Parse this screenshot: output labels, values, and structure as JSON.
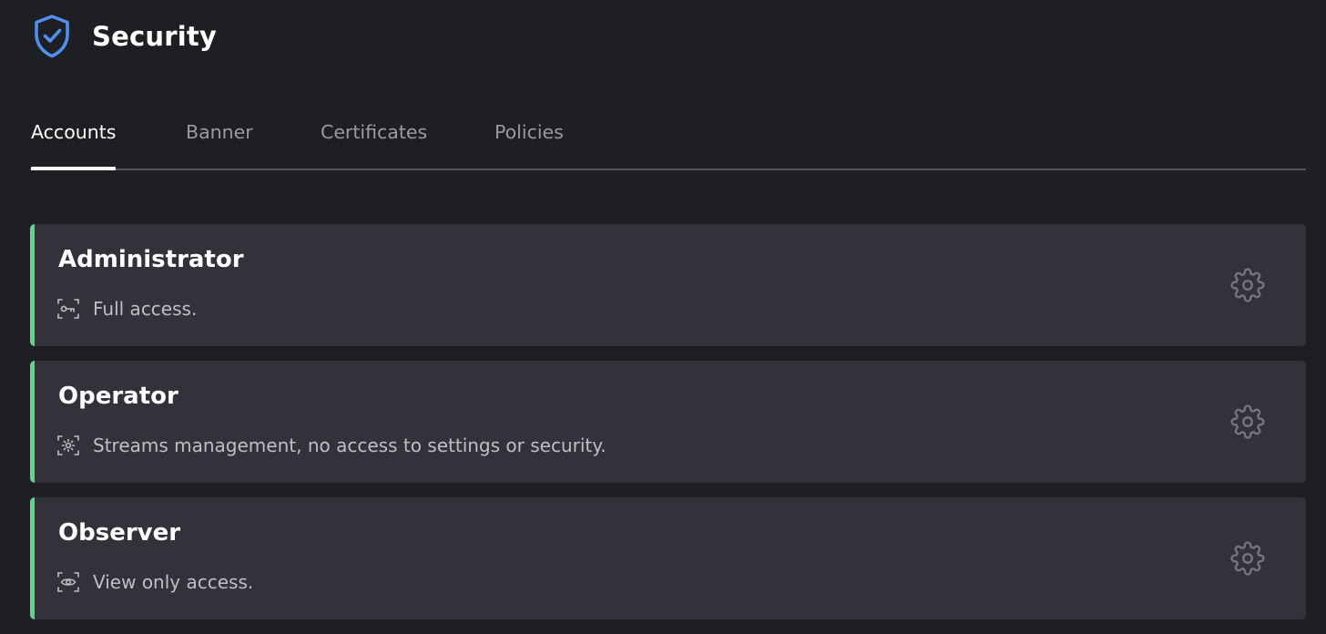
{
  "header": {
    "title": "Security",
    "icon": "shield-check-icon",
    "accent_color": "#4f8ff0"
  },
  "tabs": [
    {
      "label": "Accounts",
      "active": true
    },
    {
      "label": "Banner",
      "active": false
    },
    {
      "label": "Certificates",
      "active": false
    },
    {
      "label": "Policies",
      "active": false
    }
  ],
  "accounts": [
    {
      "role": "Administrator",
      "description": "Full access.",
      "icon": "key-icon",
      "action_icon": "gear-icon"
    },
    {
      "role": "Operator",
      "description": "Streams management, no access to settings or security.",
      "icon": "sun-icon",
      "action_icon": "gear-icon"
    },
    {
      "role": "Observer",
      "description": "View only access.",
      "icon": "eye-icon",
      "action_icon": "gear-icon"
    }
  ],
  "colors": {
    "background": "#1e1f22",
    "card": "#31323a",
    "card_accent": "#5fd68a"
  }
}
